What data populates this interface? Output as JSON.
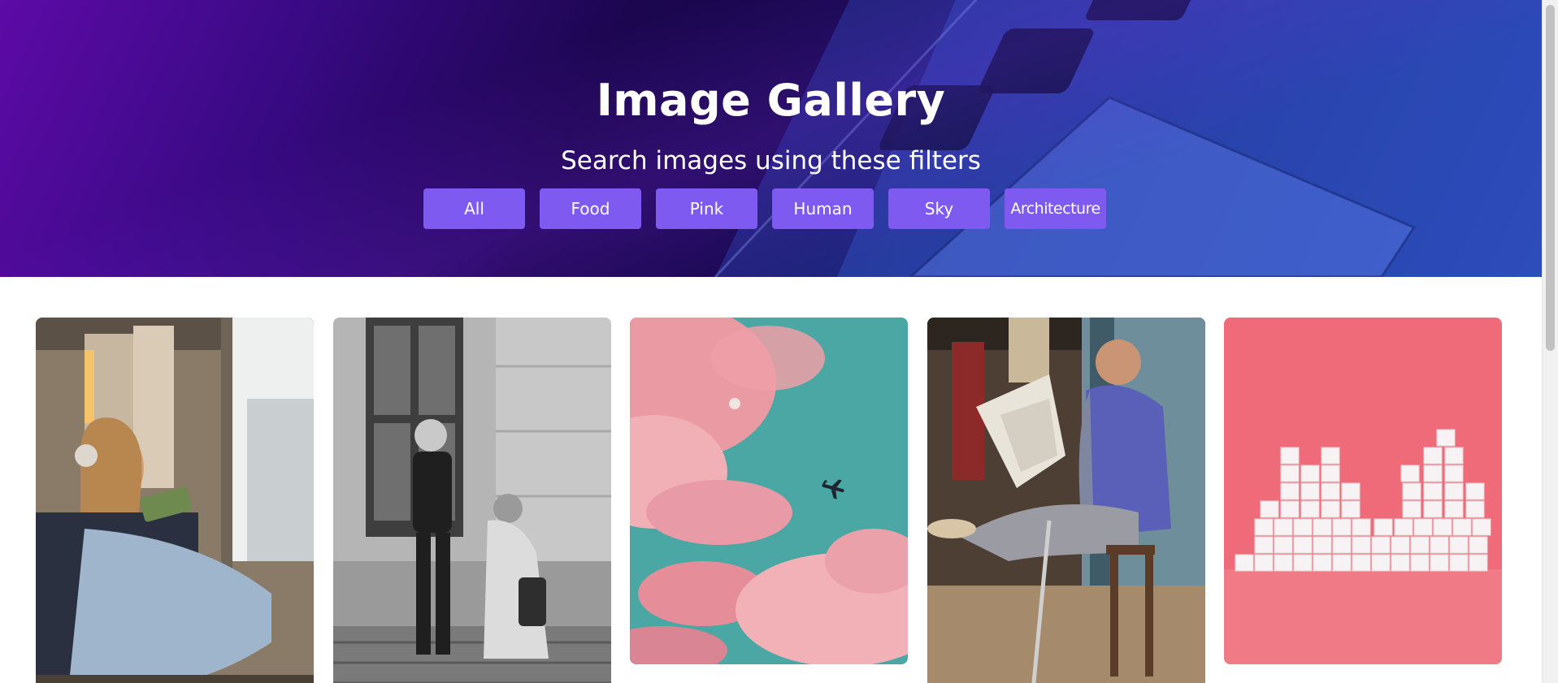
{
  "header": {
    "title": "Image Gallery",
    "subtitle": "Search images using these filters"
  },
  "filters": [
    "All",
    "Food",
    "Pink",
    "Human",
    "Sky",
    "Architecture"
  ],
  "gallery": {
    "images": [
      {
        "id": "woman-reading-train",
        "category": "Human"
      },
      {
        "id": "man-helping-elderly",
        "category": "Human"
      },
      {
        "id": "pink-clouds-plane",
        "category": "Sky"
      },
      {
        "id": "man-reading-newspaper",
        "category": "Human"
      },
      {
        "id": "sugar-cubes-pink",
        "category": "Pink"
      }
    ]
  },
  "colors": {
    "accent": "#7f5af0",
    "hero_purple": "#5d0aa6",
    "hero_blue": "#2f54c8"
  }
}
